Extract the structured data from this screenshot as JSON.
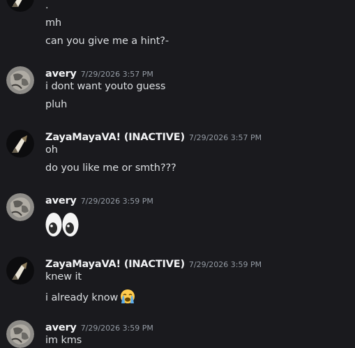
{
  "messages": [
    {
      "group": 0,
      "author": "",
      "lines": [
        ".",
        "mh",
        "can you give me a hint?-"
      ]
    },
    {
      "group": 1,
      "author": "avery",
      "timestamp": "7/29/2026 3:57 PM",
      "lines": [
        "i dont want youto guess",
        "pluh"
      ]
    },
    {
      "group": 2,
      "author": "ZayaMayaVA! (INACTIVE)",
      "timestamp": "7/29/2026 3:57 PM",
      "lines": [
        "oh",
        "do you like me or smth???"
      ]
    },
    {
      "group": 3,
      "author": "avery",
      "timestamp": "7/29/2026 3:59 PM",
      "emoji": "eyes-emoji"
    },
    {
      "group": 4,
      "author": "ZayaMayaVA! (INACTIVE)",
      "timestamp": "7/29/2026 3:59 PM",
      "lines": [
        "knew it",
        "i already know"
      ],
      "emoji": "loudly-crying-face-emoji"
    },
    {
      "group": 5,
      "author": "avery",
      "timestamp": "7/29/2026 3:59 PM",
      "lines": [
        "im kms"
      ]
    }
  ],
  "colors": {
    "background": "#1a1a1e",
    "author": "#f2f3f5",
    "timestamp": "#949ba4",
    "text": "#dbdee1"
  }
}
